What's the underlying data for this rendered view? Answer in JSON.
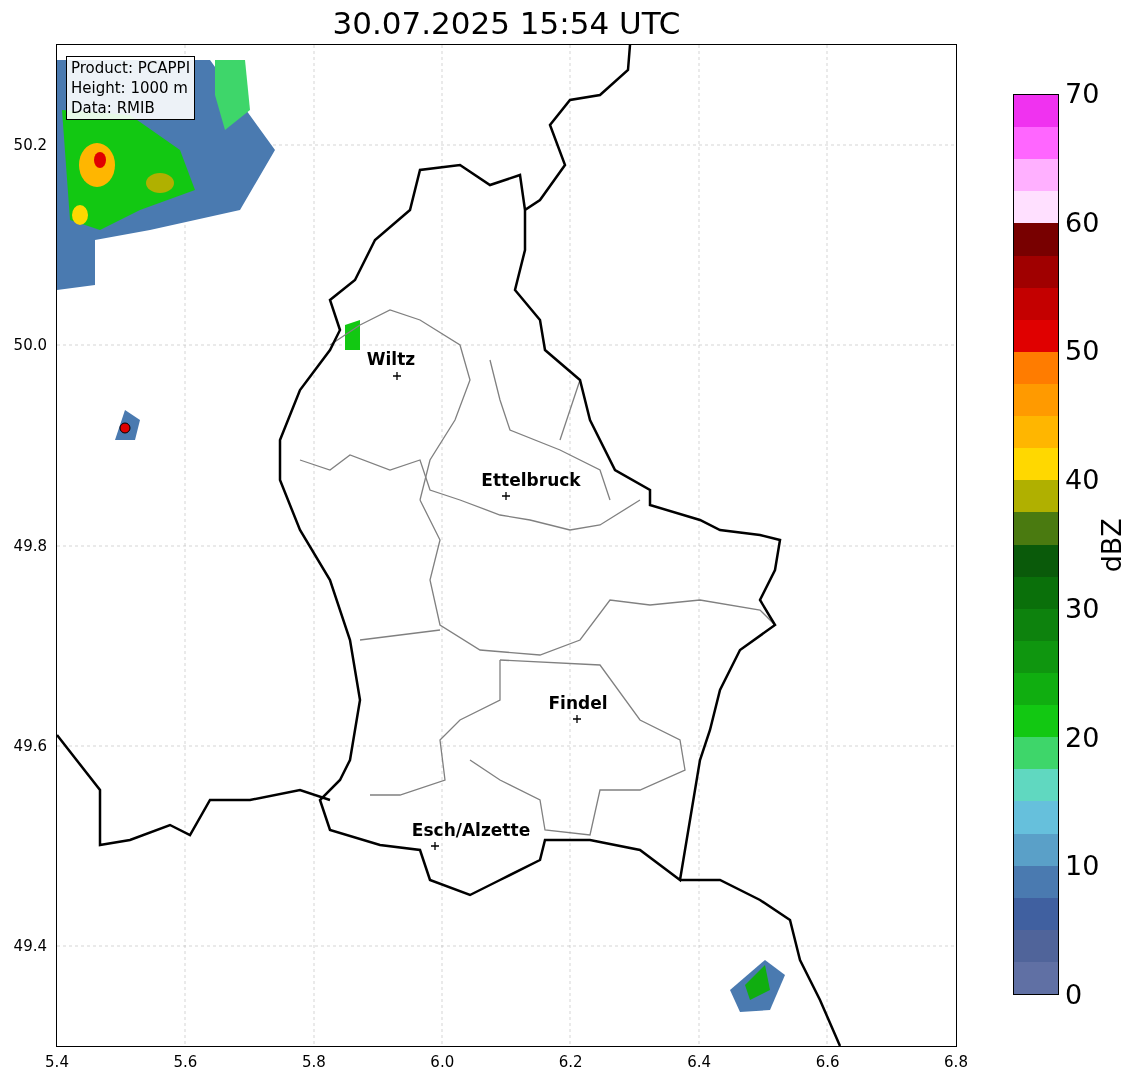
{
  "title": "30.07.2025 15:54 UTC",
  "info_box": [
    "Product: PCAPPI",
    "Height: 1000 m",
    "Data: RMIB"
  ],
  "x_ticks": [
    "5.4",
    "5.6",
    "5.8",
    "6.0",
    "6.2",
    "6.4",
    "6.6",
    "6.8"
  ],
  "y_ticks": [
    "50.2",
    "50.0",
    "49.8",
    "49.6",
    "49.4"
  ],
  "cities": [
    {
      "name": "Wiltz"
    },
    {
      "name": "Ettelbruck"
    },
    {
      "name": "Findel"
    },
    {
      "name": "Esch/Alzette"
    }
  ],
  "colorbar": {
    "label": "dBZ",
    "ticks": [
      "70",
      "60",
      "50",
      "40",
      "30",
      "20",
      "10",
      "0"
    ],
    "bands": [
      {
        "color": "#f032f0"
      },
      {
        "color": "#ff66ff"
      },
      {
        "color": "#ffb0ff"
      },
      {
        "color": "#ffe0ff"
      },
      {
        "color": "#780000"
      },
      {
        "color": "#a00000"
      },
      {
        "color": "#c40000"
      },
      {
        "color": "#e00000"
      },
      {
        "color": "#ff7c00"
      },
      {
        "color": "#ff9a00"
      },
      {
        "color": "#ffb600"
      },
      {
        "color": "#ffd800"
      },
      {
        "color": "#b0b000"
      },
      {
        "color": "#4a7a10"
      },
      {
        "color": "#0a5a0a"
      },
      {
        "color": "#0a700a"
      },
      {
        "color": "#0d820d"
      },
      {
        "color": "#0f960f"
      },
      {
        "color": "#10ae10"
      },
      {
        "color": "#12c812"
      },
      {
        "color": "#3ed66a"
      },
      {
        "color": "#60d8c0"
      },
      {
        "color": "#66c0dc"
      },
      {
        "color": "#5aa0c8"
      },
      {
        "color": "#4a7ab0"
      },
      {
        "color": "#4060a0"
      },
      {
        "color": "#50649a"
      },
      {
        "color": "#6070a4"
      }
    ]
  }
}
